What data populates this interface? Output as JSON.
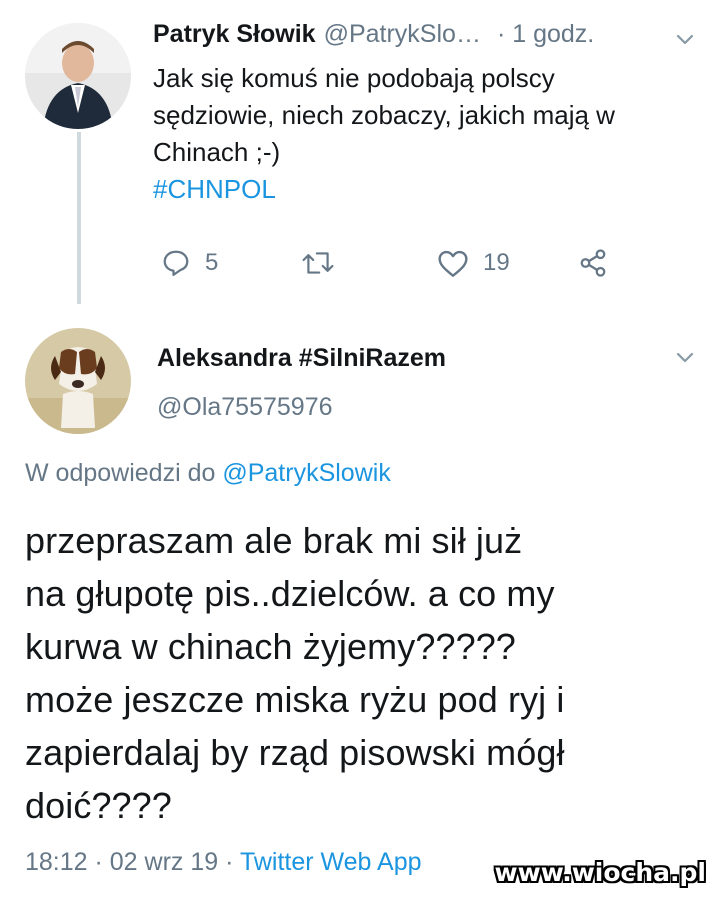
{
  "tweet1": {
    "author_name": "Patryk Słowik",
    "handle": "@PatrykSlo…",
    "time": "· 1 godz.",
    "text_lines": [
      "Jak się komuś nie podobają polscy",
      "sędziowie, niech zobaczy, jakich mają w",
      "Chinach ;-)"
    ],
    "hashtag": "#CHNPOL",
    "reply_count": "5",
    "retweet_count": "",
    "like_count": "19"
  },
  "tweet2": {
    "author_name": "Aleksandra #SilniRazem",
    "handle": "@Ola75575976",
    "reply_prefix": "W odpowiedzi do",
    "reply_mention": "@PatrykSlowik",
    "text_lines": [
      "przepraszam ale brak mi sił już",
      "na głupotę pis..dzielców. a co my",
      "kurwa w chinach żyjemy?????",
      "może jeszcze miska ryżu pod ryj i",
      "zapierdalaj by rząd pisowski mógł",
      "doić????"
    ],
    "timestamp": "18:12 · 02 wrz 19 ·",
    "source_app": "Twitter Web App"
  },
  "watermark": "www.wiocha.pl",
  "colors": {
    "link": "#1b95e0",
    "muted": "#657786",
    "text": "#14171a",
    "thread_line": "#cfd9de"
  },
  "icons": [
    "reply-icon",
    "retweet-icon",
    "like-icon",
    "share-icon",
    "chevron-down-icon"
  ]
}
